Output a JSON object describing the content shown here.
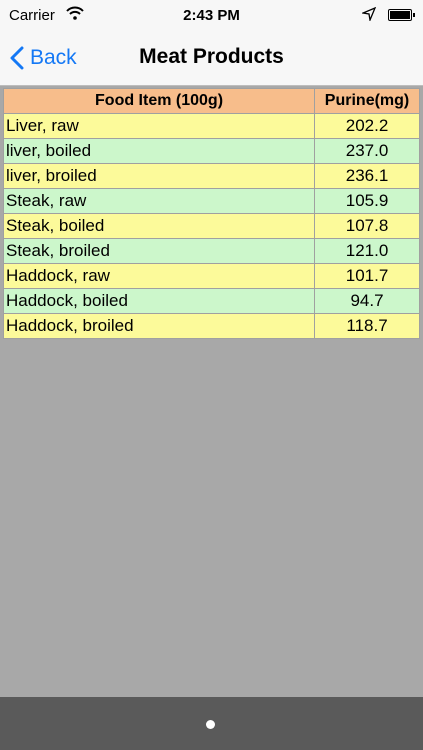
{
  "status": {
    "carrier": "Carrier",
    "time": "2:43 PM"
  },
  "nav": {
    "back_label": "Back",
    "title": "Meat Products"
  },
  "table": {
    "headers": [
      "Food Item (100g)",
      "Purine(mg)"
    ],
    "rows": [
      {
        "food": "Liver, raw",
        "purine": "202.2"
      },
      {
        "food": "liver, boiled",
        "purine": "237.0"
      },
      {
        "food": "liver, broiled",
        "purine": "236.1"
      },
      {
        "food": "Steak, raw",
        "purine": "105.9"
      },
      {
        "food": "Steak, boiled",
        "purine": "107.8"
      },
      {
        "food": "Steak, broiled",
        "purine": "121.0"
      },
      {
        "food": "Haddock, raw",
        "purine": "101.7"
      },
      {
        "food": "Haddock, boiled",
        "purine": "94.7"
      },
      {
        "food": "Haddock, broiled",
        "purine": "118.7"
      }
    ]
  },
  "colors": {
    "header_bg": "#f7bd8b",
    "row_yellow": "#fcfa9a",
    "row_green": "#ccf7cb",
    "accent": "#1478f5"
  }
}
